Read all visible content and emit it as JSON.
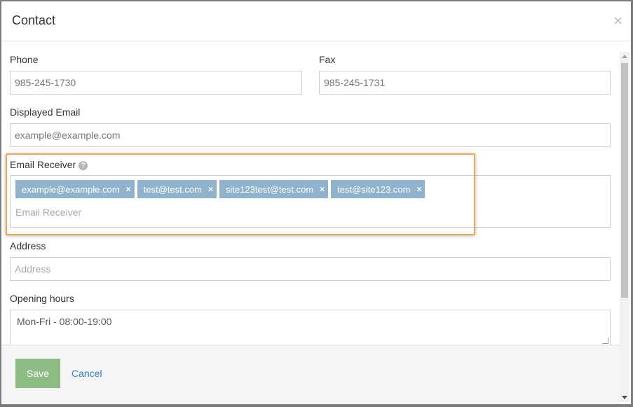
{
  "dialog": {
    "title": "Contact",
    "close_icon": "close-icon"
  },
  "phone": {
    "label": "Phone",
    "value": "985-245-1730"
  },
  "fax": {
    "label": "Fax",
    "value": "985-245-1731"
  },
  "displayed_email": {
    "label": "Displayed Email",
    "value": "example@example.com"
  },
  "email_receiver": {
    "label": "Email Receiver",
    "help_icon": "question-circle-icon",
    "tags": [
      {
        "value": "example@example.com",
        "remove": "×"
      },
      {
        "value": "test@test.com",
        "remove": "×"
      },
      {
        "value": "site123test@test.com",
        "remove": "×"
      },
      {
        "value": "test@site123.com",
        "remove": "×"
      }
    ],
    "placeholder": "Email Receiver",
    "highlight_color": "#f0a44c"
  },
  "address": {
    "label": "Address",
    "placeholder": "Address"
  },
  "opening_hours": {
    "label": "Opening hours",
    "value": "Mon-Fri - 08:00-19:00"
  },
  "footer": {
    "save_label": "Save",
    "cancel_label": "Cancel",
    "save_color": "#8cbc84",
    "cancel_color": "#2f7fc1"
  },
  "tag_color": "#8fb3cc"
}
